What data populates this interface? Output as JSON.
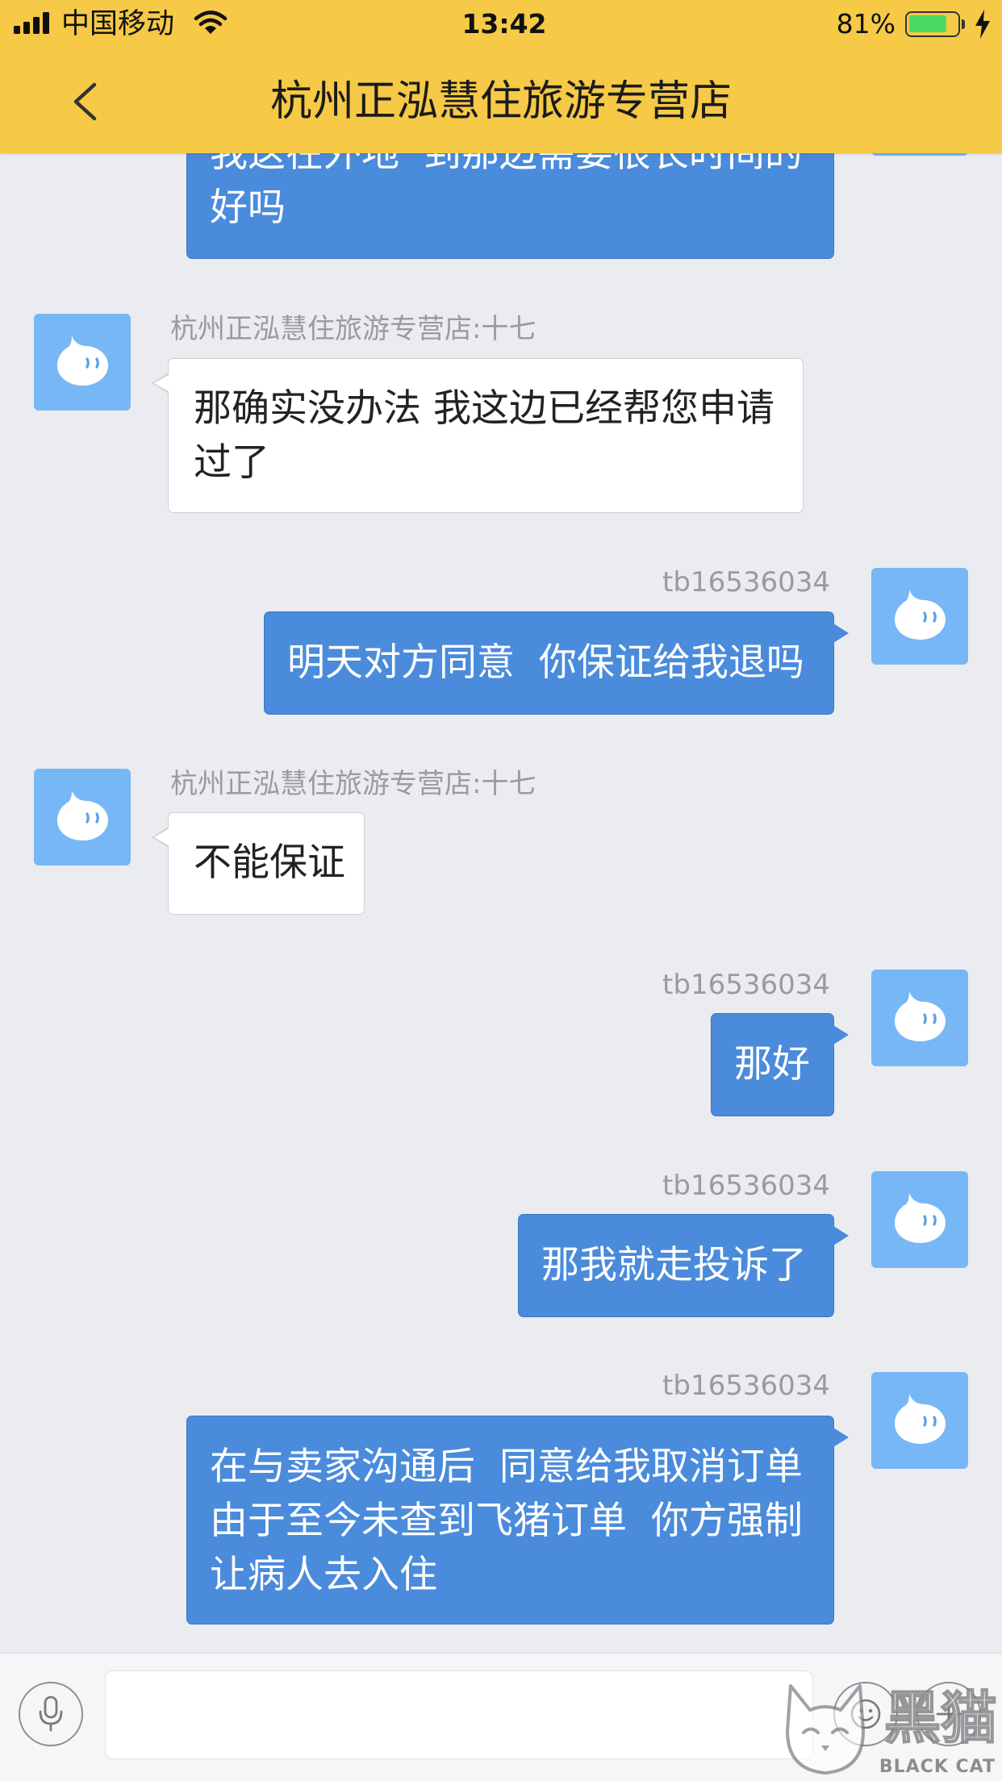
{
  "status_bar": {
    "carrier": "中国移动",
    "time": "13:42",
    "battery_text": "81%",
    "battery_level": 0.81,
    "signal_icon": "cellular-signal-icon",
    "wifi_icon": "wifi-icon",
    "charging_icon": "charging-bolt-icon"
  },
  "nav": {
    "back_icon": "chevron-left-icon",
    "title": "杭州正泓慧住旅游专营店"
  },
  "messages": [
    {
      "lines": [
        "我这在外地  到那边需要很长时间的",
        "好吗"
      ]
    },
    {
      "sender": "杭州正泓慧住旅游专营店:十七",
      "lines": [
        "那确实没办法 我这边已经帮您申请",
        "过了"
      ]
    },
    {
      "sender": "tb16536034",
      "lines": [
        "明天对方同意  你保证给我退吗"
      ]
    },
    {
      "sender": "杭州正泓慧住旅游专营店:十七",
      "lines": [
        "不能保证"
      ]
    },
    {
      "sender": "tb16536034",
      "lines": [
        "那好"
      ]
    },
    {
      "sender": "tb16536034",
      "lines": [
        "那我就走投诉了"
      ]
    },
    {
      "sender": "tb16536034",
      "lines": [
        "在与卖家沟通后  同意给我取消订单",
        "由于至今未查到飞猪订单  你方强制",
        "让病人去入住"
      ]
    }
  ],
  "input_bar": {
    "voice_icon": "microphone-icon",
    "emoji_icon": "emoji-icon",
    "more_icon": "plus-icon"
  },
  "watermark": {
    "logo_icon": "black-cat-logo-icon",
    "title": "黑猫",
    "subtitle": "BLACK CAT"
  },
  "colors": {
    "header": "#F6C946",
    "chat_background": "#EBECF0",
    "outgoing_bubble": "#4A8BDB",
    "incoming_bubble": "#FFFFFF",
    "avatar": "#78B7F5",
    "battery_fill": "#4CD964"
  }
}
